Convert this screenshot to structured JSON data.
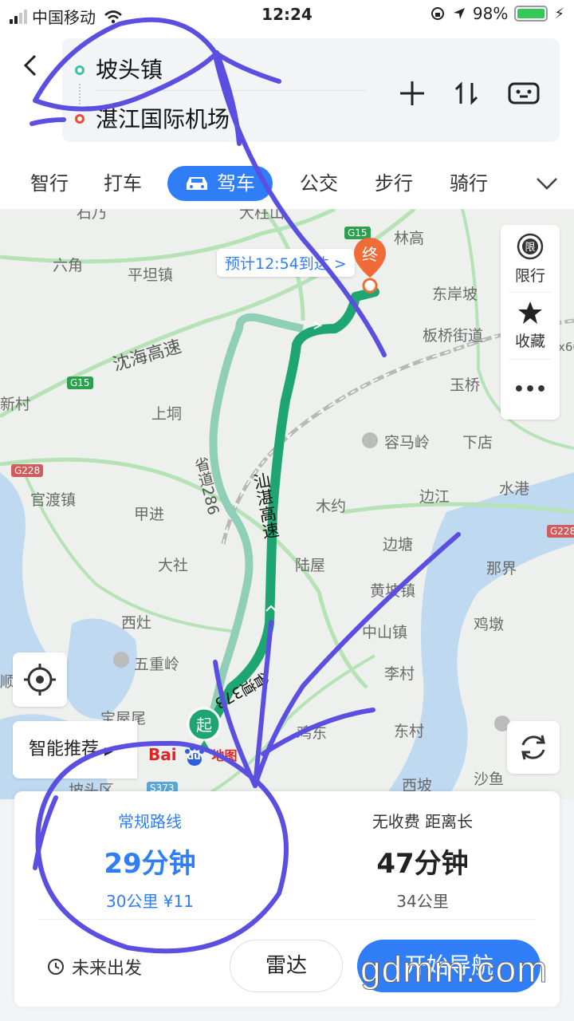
{
  "status_bar": {
    "carrier": "中国移动",
    "time": "12:24",
    "battery": "98%",
    "battery_level": 0.98
  },
  "header": {
    "from": "坡头镇",
    "to": "湛江国际机场"
  },
  "modes": [
    "智行",
    "打车",
    "驾车",
    "公交",
    "步行",
    "骑行"
  ],
  "active_mode": "驾车",
  "map": {
    "eta": "预计12:54到达 >",
    "end_marker": "终",
    "start_marker": "起",
    "side_panel": {
      "restrict_glyph": "限",
      "restrict": "限行",
      "favorite": "收藏",
      "more": "•••"
    },
    "smart_recommend": "智能推荐",
    "logo_text": "Bai",
    "logo_paw": "du",
    "logo_suffix": "地图",
    "labels": {
      "l1": "林高",
      "l2": "六角",
      "l3": "平坦镇",
      "l4": "东岸坡",
      "l5": "板桥街道",
      "l6": "沈海高速",
      "l7": "新村",
      "l8": "上垌",
      "l9": "玉桥",
      "l10": "容马岭",
      "l11": "下店",
      "l12": "官渡镇",
      "l13": "甲进",
      "l14": "木约",
      "l15": "边江",
      "l16": "水港",
      "l17": "边塘",
      "l18": "大社",
      "l19": "陆屋",
      "l20": "那界",
      "l21": "黄坡镇",
      "l22": "西灶",
      "l23": "中山镇",
      "l24": "鸡墩",
      "l25": "五重岭",
      "l26": "李村",
      "l27": "鸡东",
      "l28": "东村",
      "l29": "宝屋尾",
      "l30": "西坡",
      "l31": "坡头区",
      "l32": "沙鱼",
      "l33": "大柱山",
      "l34": "石乃",
      "road1": "汕湛高速",
      "road2": "省道286",
      "road3": "省道373",
      "l35": "顺",
      "l36": "x60"
    },
    "shields": {
      "s1": "G15",
      "s2": "G15",
      "s3": "G228",
      "s4": "G228",
      "s5": "S373"
    }
  },
  "route_card": {
    "options": [
      {
        "name": "常规路线",
        "time": "29分钟",
        "info": "30公里 ¥11",
        "selected": true
      },
      {
        "name": "无收费 距离长",
        "time": "47分钟",
        "info": "34公里",
        "selected": false
      }
    ],
    "future": "未来出发",
    "radar": "雷达",
    "start_nav": "开始导航"
  },
  "watermark": "gdmm.com",
  "colors": {
    "accent": "#2f7ef7",
    "route_main": "#1ea672",
    "route_alt": "#8fcfb8",
    "end_pin": "#ef6b37",
    "doodle": "#5a4fe0"
  }
}
